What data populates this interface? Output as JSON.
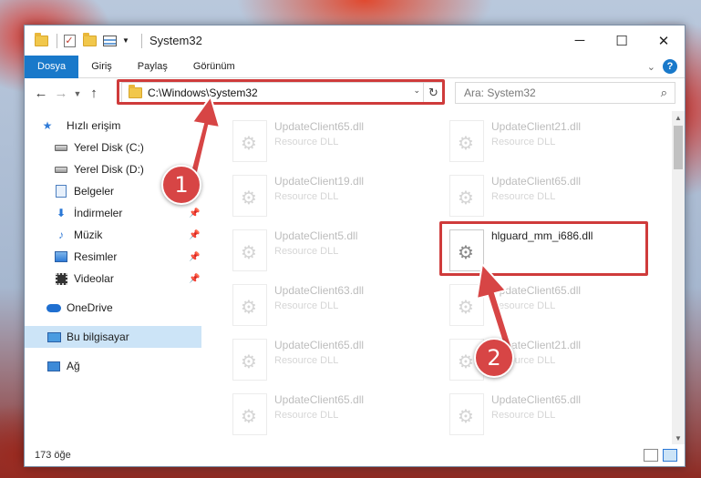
{
  "window": {
    "title": "System32",
    "controls": {
      "minimize": "─",
      "maximize": "☐",
      "close": "✕"
    }
  },
  "ribbon": {
    "tabs": [
      "Dosya",
      "Giriş",
      "Paylaş",
      "Görünüm"
    ],
    "help": "?"
  },
  "address": {
    "path": "C:\\Windows\\System32",
    "search_placeholder": "Ara: System32"
  },
  "sidebar": {
    "items": [
      {
        "label": "Hızlı erişim",
        "icon": "star-icon"
      },
      {
        "label": "Yerel Disk (C:)",
        "icon": "drive-icon"
      },
      {
        "label": "Yerel Disk (D:)",
        "icon": "drive-icon"
      },
      {
        "label": "Belgeler",
        "icon": "documents-icon"
      },
      {
        "label": "İndirmeler",
        "icon": "download-icon"
      },
      {
        "label": "Müzik",
        "icon": "music-icon"
      },
      {
        "label": "Resimler",
        "icon": "pictures-icon"
      },
      {
        "label": "Videolar",
        "icon": "videos-icon"
      },
      {
        "label": "OneDrive",
        "icon": "onedrive-icon"
      },
      {
        "label": "Bu bilgisayar",
        "icon": "this-pc-icon"
      },
      {
        "label": "Ağ",
        "icon": "network-icon"
      }
    ],
    "pin_glyph": "📌"
  },
  "files": [
    {
      "name": "UpdateClient65.dll",
      "type": "Resource DLL"
    },
    {
      "name": "UpdateClient21.dll",
      "type": "Resource DLL"
    },
    {
      "name": "UpdateClient19.dll",
      "type": "Resource DLL"
    },
    {
      "name": "UpdateClient65.dll",
      "type": "Resource DLL"
    },
    {
      "name": "UpdateClient5.dll",
      "type": "Resource DLL"
    },
    {
      "name": "hlguard_mm_i686.dll",
      "type": ""
    },
    {
      "name": "UpdateClient63.dll",
      "type": "Resource DLL"
    },
    {
      "name": "UpdateClient65.dll",
      "type": "Resource DLL"
    },
    {
      "name": "UpdateClient65.dll",
      "type": "Resource DLL"
    },
    {
      "name": "UpdateClient21.dll",
      "type": "Resource DLL"
    },
    {
      "name": "UpdateClient65.dll",
      "type": "Resource DLL"
    },
    {
      "name": "UpdateClient65.dll",
      "type": "Resource DLL"
    }
  ],
  "status": {
    "count": "173 öğe"
  },
  "callouts": {
    "step1": "1",
    "step2": "2"
  },
  "colors": {
    "accent": "#1979ca",
    "highlight": "#cf3b3b",
    "selected": "#cce4f7"
  }
}
